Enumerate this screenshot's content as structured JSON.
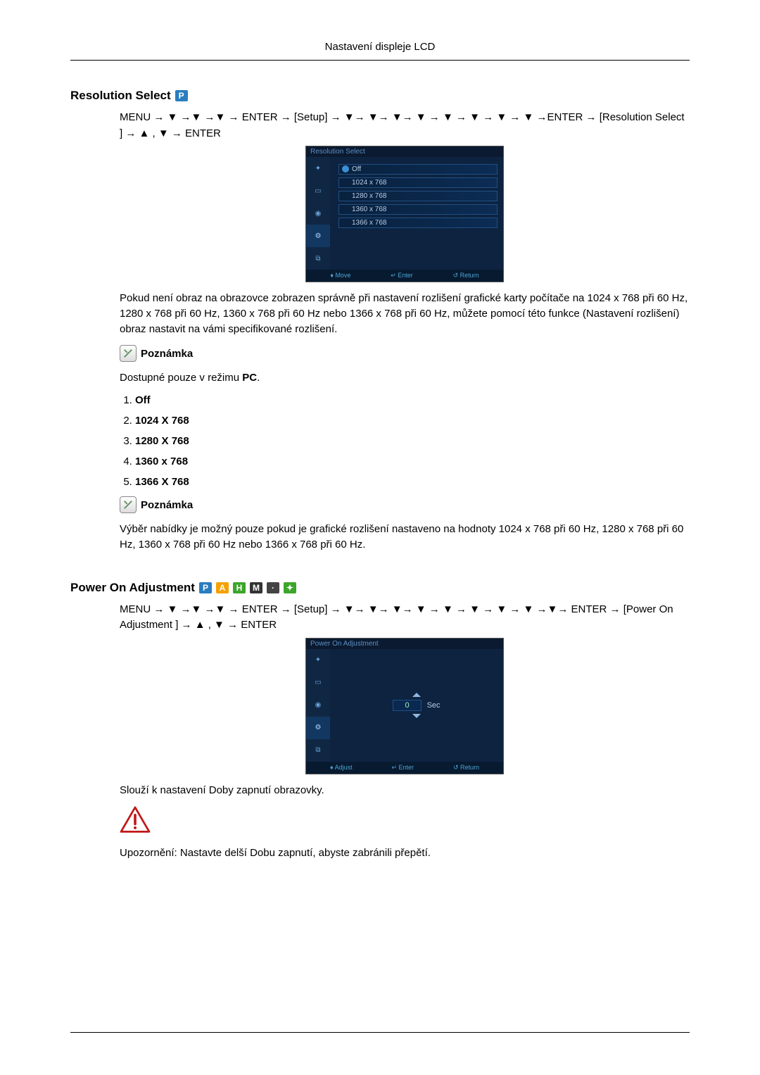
{
  "header": {
    "title": "Nastavení displeje LCD"
  },
  "section1": {
    "title": "Resolution Select",
    "badges": [
      "P"
    ],
    "nav": "MENU → ▼ →▼ →▼ → ENTER → [Setup] → ▼→ ▼→ ▼→ ▼ → ▼ → ▼ → ▼ → ▼ →ENTER → [Resolution Select ] → ▲ , ▼ → ENTER",
    "osd": {
      "title": "Resolution Select",
      "options": {
        "off": "Off",
        "r1": "1024 x 768",
        "r2": "1280 x 768",
        "r3": "1360 x 768",
        "r4": "1366 x 768"
      },
      "footer": {
        "move": "Move",
        "enter": "Enter",
        "return": "Return"
      }
    },
    "para1": "Pokud není obraz na obrazovce zobrazen správně při nastavení rozlišení grafické karty počítače na 1024 x 768 při 60 Hz, 1280 x 768 při 60 Hz, 1360 x 768 při 60 Hz nebo 1366 x 768 při 60 Hz, můžete pomocí této funkce (Nastavení rozlišení) obraz nastavit na vámi specifikované rozlišení.",
    "note_label": "Poznámka",
    "para2_pre": "Dostupné pouze v režimu ",
    "para2_bold": "PC",
    "list": {
      "i1": "Off",
      "i2": "1024 X 768",
      "i3": "1280 X 768",
      "i4": "1360 x 768",
      "i5": "1366 X 768"
    },
    "para3": "Výběr nabídky je možný pouze pokud je grafické rozlišení nastaveno na hodnoty 1024 x 768 při 60 Hz, 1280 x 768 při 60 Hz, 1360 x 768 při 60 Hz nebo 1366 x 768 při 60 Hz."
  },
  "section2": {
    "title": "Power On Adjustment",
    "badges": [
      "P",
      "A",
      "H",
      "M"
    ],
    "nav": "MENU → ▼ →▼ →▼ → ENTER → [Setup] → ▼→ ▼→ ▼→ ▼ → ▼ → ▼ → ▼ → ▼ →▼→ ENTER → [Power On Adjustment ] → ▲ , ▼ → ENTER",
    "osd": {
      "title": "Power On Adjustment",
      "value": "0",
      "unit": "Sec",
      "footer": {
        "adjust": "Adjust",
        "enter": "Enter",
        "return": "Return"
      }
    },
    "para1": "Slouží k nastavení Doby zapnutí obrazovky.",
    "para2": "Upozornění: Nastavte delší Dobu zapnutí, abyste zabránili přepětí."
  }
}
